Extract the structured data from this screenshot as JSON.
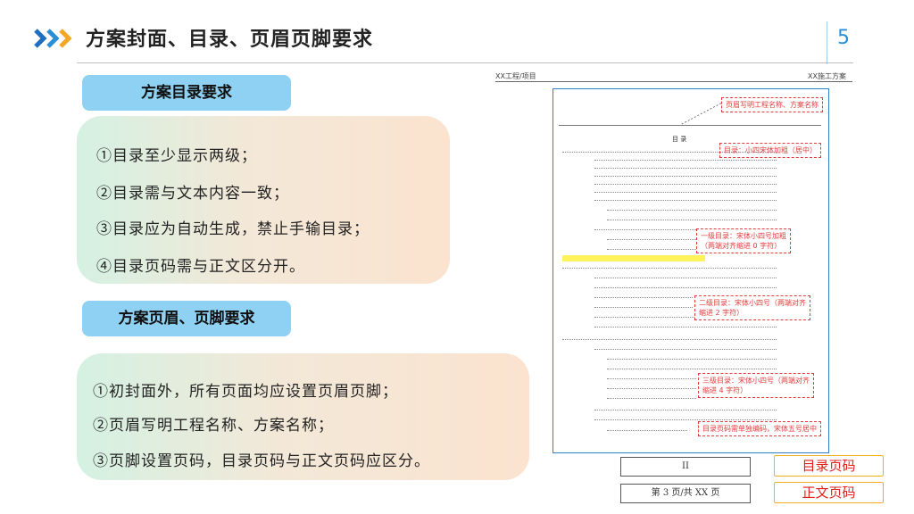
{
  "header": {
    "title": "方案封面、目录、页眉页脚要求",
    "page_number": "5"
  },
  "toc_section": {
    "label": "方案目录要求",
    "items": [
      "①目录至少显示两级；",
      "②目录需与文本内容一致；",
      "③目录应为自动生成，禁止手输目录；",
      "④目录页码需与正文区分开。"
    ]
  },
  "header_footer_section": {
    "label": "方案页眉、页脚要求",
    "items": [
      "①初封面外，所有页面均应设置页眉页脚；",
      "②页眉写明工程名称、方案名称；",
      "③页脚设置页码，目录页码与正文页码应区分。"
    ]
  },
  "document_preview": {
    "running_header_left": "XX工程/项目",
    "running_header_right": "XX施工方案",
    "callouts": {
      "header": "页眉写明工程名称、方案名称",
      "toc_title": "目录：小四宋体加粗（居中）",
      "level1": "一级目录：宋体小四号加粗",
      "level1_b": "（两端对齐缩进 0 字符）",
      "level2": "二级目录：宋体小四号（两端对齐",
      "level2_b": "缩进 2 字符）",
      "level3": "三级目录：宋体小四号（两端对齐",
      "level3_b": "缩进 4 字符）",
      "page_no": "目录页码需单独编码，宋体五号居中"
    },
    "footer_roman": "II",
    "footer_page": "第 3 页/共 XX 页"
  },
  "tags": {
    "toc_page": "目录页码",
    "body_page": "正文页码"
  },
  "colors": {
    "accent_blue": "#2a8fd6",
    "pill_blue": "#8fd1f2",
    "callout_red": "#e03c3c",
    "tag_border": "#f0b020"
  }
}
